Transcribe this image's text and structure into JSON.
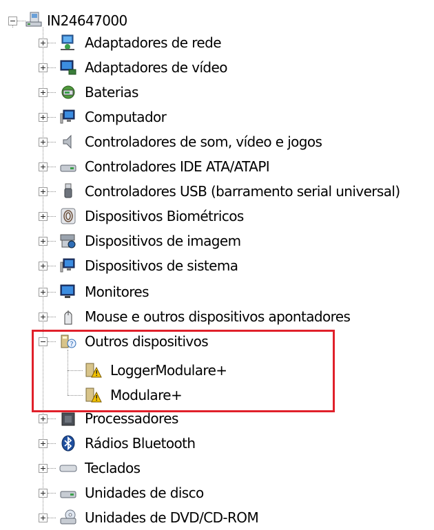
{
  "tree": {
    "root": {
      "label": "IN24647000",
      "icon": "computer-root-icon",
      "expanded": true
    },
    "categories": [
      {
        "label": "Adaptadores de rede",
        "icon": "network-adapter-icon",
        "expanded": false
      },
      {
        "label": "Adaptadores de vídeo",
        "icon": "display-adapter-icon",
        "expanded": false
      },
      {
        "label": "Baterias",
        "icon": "battery-icon",
        "expanded": false
      },
      {
        "label": "Computador",
        "icon": "computer-icon",
        "expanded": false
      },
      {
        "label": "Controladores de som, vídeo e jogos",
        "icon": "speaker-icon",
        "expanded": false
      },
      {
        "label": "Controladores IDE ATA/ATAPI",
        "icon": "ide-controller-icon",
        "expanded": false
      },
      {
        "label": "Controladores USB (barramento serial universal)",
        "icon": "usb-icon",
        "expanded": false
      },
      {
        "label": "Dispositivos Biométricos",
        "icon": "fingerprint-icon",
        "expanded": false
      },
      {
        "label": "Dispositivos de imagem",
        "icon": "camera-icon",
        "expanded": false
      },
      {
        "label": "Dispositivos de sistema",
        "icon": "system-devices-icon",
        "expanded": false
      },
      {
        "label": "Monitores",
        "icon": "monitor-icon",
        "expanded": false
      },
      {
        "label": "Mouse e outros dispositivos apontadores",
        "icon": "mouse-icon",
        "expanded": false
      },
      {
        "label": "Outros dispositivos",
        "icon": "unknown-device-icon",
        "expanded": true,
        "children": [
          {
            "label": "LoggerModulare+",
            "icon": "warning-device-icon"
          },
          {
            "label": "Modulare+",
            "icon": "warning-device-icon"
          }
        ]
      },
      {
        "label": "Processadores",
        "icon": "processor-icon",
        "expanded": false
      },
      {
        "label": "Rádios Bluetooth",
        "icon": "bluetooth-icon",
        "expanded": false
      },
      {
        "label": "Teclados",
        "icon": "keyboard-icon",
        "expanded": false
      },
      {
        "label": "Unidades de disco",
        "icon": "disk-drive-icon",
        "expanded": false
      },
      {
        "label": "Unidades de DVD/CD-ROM",
        "icon": "dvd-drive-icon",
        "expanded": false
      }
    ]
  },
  "colors": {
    "highlight_border": "#e0202a",
    "tree_lines": "#8c8c8c",
    "warning": "#f2c200"
  }
}
